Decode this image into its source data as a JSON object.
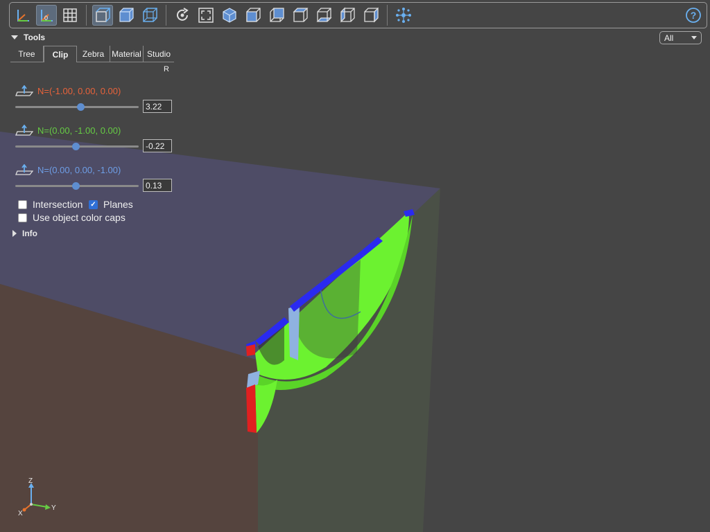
{
  "toolbar": {
    "buttons": [
      {
        "name": "axes-toggle-icon",
        "active": false
      },
      {
        "name": "axes-origin-icon",
        "active": true,
        "label": "0"
      },
      {
        "name": "grid-icon",
        "active": false
      },
      {
        "name": "perspective-camera-icon",
        "active": true
      },
      {
        "name": "ortho-cube-icon",
        "active": false
      },
      {
        "name": "transparent-cube-icon",
        "active": false
      },
      {
        "name": "reset-view-icon",
        "active": false
      },
      {
        "name": "fit-view-icon",
        "active": false
      },
      {
        "name": "iso-view-icon",
        "active": false
      },
      {
        "name": "front-view-icon",
        "active": false
      },
      {
        "name": "rear-view-icon",
        "active": false
      },
      {
        "name": "top-view-icon",
        "active": false
      },
      {
        "name": "bottom-view-icon",
        "active": false
      },
      {
        "name": "left-view-icon",
        "active": false
      },
      {
        "name": "right-view-icon",
        "active": false
      },
      {
        "name": "explode-icon",
        "active": false
      }
    ],
    "help_label": "?"
  },
  "panel": {
    "title": "Tools",
    "tabs": [
      {
        "label": "Tree",
        "active": false
      },
      {
        "label": "Clip",
        "active": true
      },
      {
        "label": "Zebra",
        "active": false
      },
      {
        "label": "Material",
        "active": false
      },
      {
        "label": "Studio",
        "active": false
      }
    ],
    "r_label": "R",
    "clip_planes": [
      {
        "normal": "N=(-1.00, 0.00, 0.00)",
        "value": "3.22",
        "color": "#e8623a",
        "fraction": 0.53
      },
      {
        "normal": "N=(0.00, -1.00, 0.00)",
        "value": "-0.22",
        "color": "#66cc44",
        "fraction": 0.49
      },
      {
        "normal": "N=(0.00, 0.00, -1.00)",
        "value": "0.13",
        "color": "#6e9ee6",
        "fraction": 0.49
      }
    ],
    "intersection_label": "Intersection",
    "intersection_checked": false,
    "planes_label": "Planes",
    "planes_checked": true,
    "object_color_caps_label": "Use object color caps",
    "object_color_caps_checked": false,
    "info_label": "Info"
  },
  "filter_select": {
    "value": "All"
  },
  "axes_gizmo": {
    "z": "Z",
    "x": "X",
    "y": "Y"
  }
}
